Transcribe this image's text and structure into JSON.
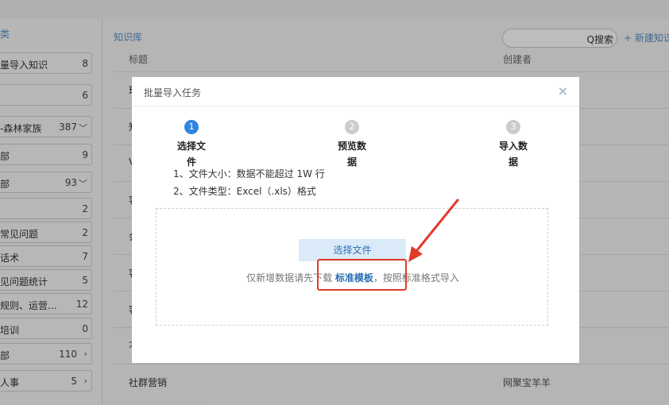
{
  "sidebar": {
    "header": "类",
    "items": [
      {
        "label": "量导入知识",
        "count": "8",
        "caret": ""
      },
      {
        "label": "",
        "count": "6",
        "caret": ""
      },
      {
        "label": "-森林家族",
        "count": "387",
        "caret": "﹀"
      },
      {
        "label": "部",
        "count": "9",
        "caret": ""
      },
      {
        "label": "部",
        "count": "93",
        "caret": "﹀"
      },
      {
        "label": "",
        "count": "2",
        "caret": ""
      },
      {
        "label": "常见问题",
        "count": "2",
        "caret": ""
      },
      {
        "label": "话术",
        "count": "7",
        "caret": ""
      },
      {
        "label": "见问题统计",
        "count": "5",
        "caret": ""
      },
      {
        "label": "规则、运营...",
        "count": "12",
        "caret": ""
      },
      {
        "label": "培训",
        "count": "0",
        "caret": ""
      },
      {
        "label": "部",
        "count": "110",
        "caret": "›"
      },
      {
        "label": "人事",
        "count": "5",
        "caret": "›"
      }
    ]
  },
  "main": {
    "breadcrumb": "知识库",
    "search_label": "Q搜索",
    "new_button": "+ 新建知识",
    "col_title": "标题",
    "col_creator": "创建者",
    "rows": [
      {
        "title": "玛",
        "creator": ""
      },
      {
        "title": "知",
        "creator": ""
      },
      {
        "title": "V",
        "creator": ""
      },
      {
        "title": "客",
        "creator": ""
      },
      {
        "title": "会",
        "creator": ""
      },
      {
        "title": "客",
        "creator": ""
      },
      {
        "title": "客",
        "creator": ""
      },
      {
        "title": "不",
        "creator": ""
      },
      {
        "title": "社群营销",
        "creator": "网聚宝羊羊"
      }
    ]
  },
  "modal": {
    "title": "批量导入任务",
    "close": "×",
    "steps": [
      {
        "num": "1",
        "label": "选择文件"
      },
      {
        "num": "2",
        "label": "预览数据"
      },
      {
        "num": "3",
        "label": "导入数据"
      }
    ],
    "rule1": "1、文件大小：数据不能超过 1W 行",
    "rule2": "2、文件类型：Excel（.xls）格式",
    "choose_file": "选择文件",
    "hint_prefix": "仅新增数据请先下载",
    "template_link": "标准模板",
    "hint_suffix": "，按照标准格式导入"
  },
  "annotation": {
    "color": "#e23a2a"
  }
}
